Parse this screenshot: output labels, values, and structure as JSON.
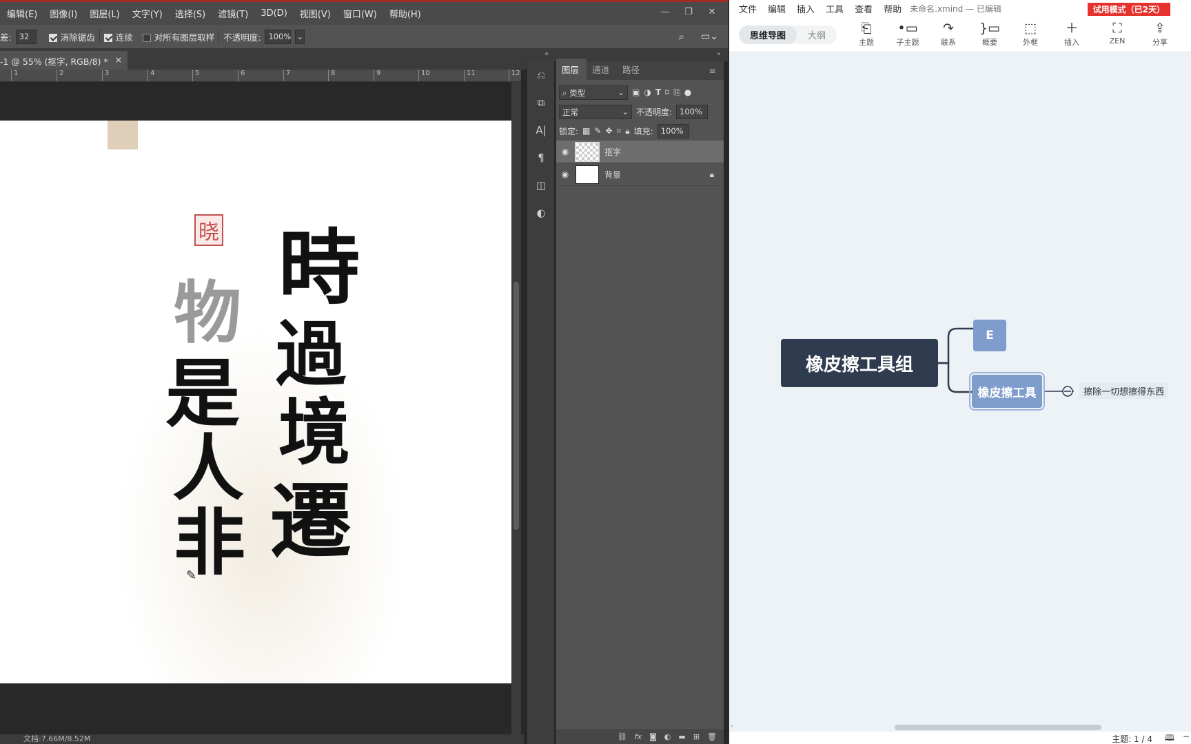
{
  "photoshop": {
    "menu": [
      "编辑(E)",
      "图像(I)",
      "图层(L)",
      "文字(Y)",
      "选择(S)",
      "滤镜(T)",
      "3D(D)",
      "视图(V)",
      "窗口(W)",
      "帮助(H)"
    ],
    "options": {
      "tolerance_prefix": "差:",
      "tolerance_value": "32",
      "antialias_label": "消除锯齿",
      "contiguous_label": "连续",
      "sample_all_label": "对所有图层取样",
      "opacity_label": "不透明度:",
      "opacity_value": "100%"
    },
    "doc_tab": "-1 @ 55% (抠字, RGB/8) *",
    "ruler_ticks": [
      "1",
      "2",
      "3",
      "4",
      "5",
      "6",
      "7",
      "8",
      "9",
      "10",
      "11",
      "12"
    ],
    "calligraphy": {
      "seal": "晓",
      "right_column": [
        "時",
        "過",
        "境",
        "遷"
      ],
      "left_column": [
        "物",
        "是",
        "人",
        "非"
      ]
    },
    "status": "文档:7.66M/8.52M",
    "layers_panel": {
      "tabs": [
        "图层",
        "通道",
        "路径"
      ],
      "filter_label": "类型",
      "blend_mode": "正常",
      "opacity_label": "不透明度:",
      "opacity_value": "100%",
      "lock_label": "锁定:",
      "fill_label": "填充:",
      "fill_value": "100%",
      "layers": [
        {
          "name": "抠字",
          "selected": true
        },
        {
          "name": "背景",
          "selected": false
        }
      ]
    }
  },
  "xmind": {
    "menu": [
      "文件",
      "编辑",
      "插入",
      "工具",
      "查看",
      "帮助"
    ],
    "file_title": "未命名.xmind — 已编辑",
    "trial_badge": "试用模式（已2天）",
    "modes": [
      "思维导图",
      "大纲"
    ],
    "toolbar": [
      {
        "label": "主题",
        "icon": "topic-icon"
      },
      {
        "label": "子主题",
        "icon": "subtopic-icon"
      },
      {
        "label": "联系",
        "icon": "relationship-icon"
      },
      {
        "label": "概要",
        "icon": "summary-icon"
      },
      {
        "label": "外框",
        "icon": "boundary-icon"
      },
      {
        "label": "插入",
        "icon": "insert-icon"
      },
      {
        "label": "ZEN",
        "icon": "zen-icon"
      },
      {
        "label": "分享",
        "icon": "share-icon"
      }
    ],
    "map": {
      "central": "橡皮擦工具组",
      "child_1": "E",
      "child_2": "橡皮擦工具",
      "child_2_note": "擦除一切想擦得东西"
    },
    "status": {
      "topics": "主题: 1 / 4"
    },
    "colors": {
      "central_topic": "#2f3b4e",
      "main_topic": "#7e9ccc",
      "canvas": "#edf2f6",
      "trial_badge": "#e5322d"
    }
  }
}
